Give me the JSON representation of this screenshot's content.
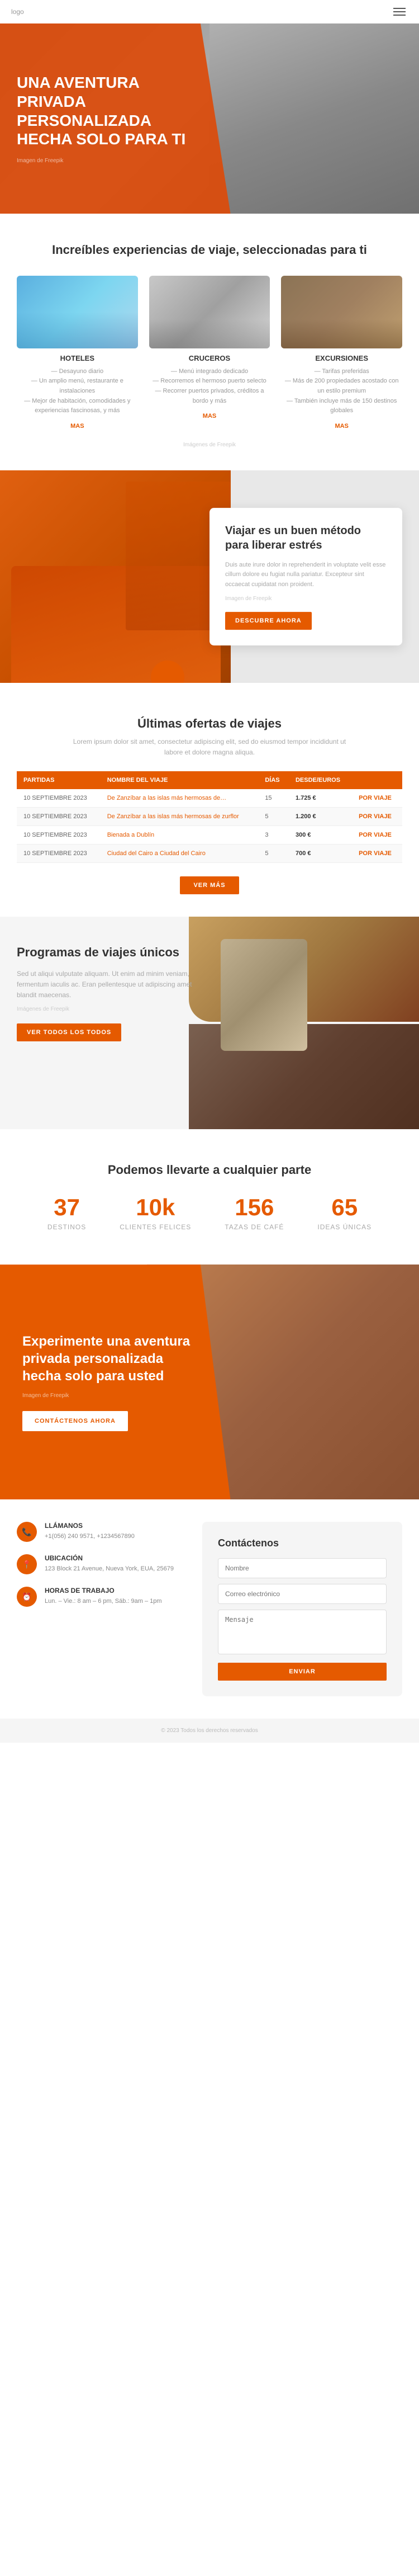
{
  "nav": {
    "logo": "logo",
    "menu_icon": "≡"
  },
  "hero": {
    "title": "UNA AVENTURA PRIVADA PERSONALIZADA HECHA SOLO PARA TI",
    "source": "Imagen de Freepik"
  },
  "experiences": {
    "section_title": "Increíbles experiencias de viaje, seleccionadas para ti",
    "cards": [
      {
        "id": "hotels",
        "title": "HOTELES",
        "desc": "— Desayuno diario\n— Un amplio menú, restaurante e instalaciones\n— Mejor de habitación, comodidades y experiencias fascinosas, y más",
        "link": "MAS"
      },
      {
        "id": "cruises",
        "title": "CRUCEROS",
        "desc": "— Menú integrado dedicado\n— Recorremos el hermoso puerto selecto\n— Recorrer puertos privados, créditos a bordo y más",
        "link": "MAS"
      },
      {
        "id": "excursions",
        "title": "EXCURSIONES",
        "desc": "— Tarifas preferidas\n— Más de 200 propiedades acostado con un estilo premium\n— También incluye más de 150 destinos globales",
        "link": "MAS"
      }
    ],
    "image_source": "Imágenes de Freepik"
  },
  "stress": {
    "title": "Viajar es un buen método para liberar estrés",
    "desc": "Duis aute irure dolor in reprehenderit in voluptate velit esse cillum dolore eu fugiat nulla pariatur. Excepteur sint occaecat cupidatat non proident.",
    "source": "Imagen de Freepik",
    "button": "DESCUBRE AHORA"
  },
  "offers": {
    "section_title": "Últimas ofertas de viajes",
    "desc": "Lorem ipsum dolor sit amet, consectetur adipiscing elit, sed do eiusmod tempor incididunt ut labore et dolore magna aliqua.",
    "table_headers": [
      "PARTIDAS",
      "NOMBRE DEL VIAJE",
      "DÍAS",
      "DESDE/EUROS"
    ],
    "rows": [
      {
        "date": "10 SEPTIEMBRE 2023",
        "name": "De Zanzíbar a las islas más hermosas de…",
        "days": "15",
        "price": "1.725 €",
        "per": "POR VIAJE"
      },
      {
        "date": "10 SEPTIEMBRE 2023",
        "name": "De Zanzíbar a las islas más hermosas de zurflor",
        "days": "5",
        "price": "1.200 €",
        "per": "POR VIAJE"
      },
      {
        "date": "10 SEPTIEMBRE 2023",
        "name": "Bienada a Dublín",
        "days": "3",
        "price": "300 €",
        "per": "POR VIAJE"
      },
      {
        "date": "10 SEPTIEMBRE 2023",
        "name": "Ciudad del Cairo a Ciudad del Cairo",
        "days": "5",
        "price": "700 €",
        "per": "POR VIAJE"
      }
    ],
    "more_button": "VER MÁS"
  },
  "programs": {
    "section_title": "Programas de viajes únicos",
    "desc": "Sed ut aliqui vulputate aliquam. Ut enim ad minim veniam, fermentum iaculis ac. Eran pellentesque ut adipiscing amet blandit maecenas.",
    "source": "Imágenes de Freepik",
    "button": "VER TODOS LOS TODOS"
  },
  "stats": {
    "items": [
      {
        "number": "37",
        "label": "DESTINOS"
      },
      {
        "number": "10k",
        "label": "CLIENTES FELICES"
      },
      {
        "number": "156",
        "label": "TAZAS DE CAFÉ"
      },
      {
        "number": "65",
        "label": "IDEAS ÚNICAS"
      }
    ]
  },
  "cta": {
    "title": "Experimente una aventura privada personalizada hecha solo para usted",
    "source": "Imagen de Freepik",
    "button": "CONTÁCTENOS AHORA"
  },
  "footer": {
    "contact_title": "Contáctenos",
    "items": [
      {
        "id": "phone",
        "icon": "📞",
        "title": "LLÁMANOS",
        "text": "+1(056) 240 9571, +1234567890"
      },
      {
        "id": "location",
        "icon": "📍",
        "title": "UBICACIÓN",
        "text": "123 Block 21 Avenue, Nueva York, EUA, 25679"
      },
      {
        "id": "hours",
        "icon": "⏰",
        "title": "HORAS DE TRABAJO",
        "text": "Lun. – Vie.: 8 am – 6 pm, Sáb.: 9am – 1pm"
      }
    ],
    "form": {
      "title": "Contáctenos",
      "name_placeholder": "Nombre",
      "email_placeholder": "Correo electrónico",
      "message_placeholder": "Mensaje",
      "button": "ENVIAR"
    }
  },
  "footer_bottom": {
    "text": "© 2023 Todos los derechos reservados"
  }
}
